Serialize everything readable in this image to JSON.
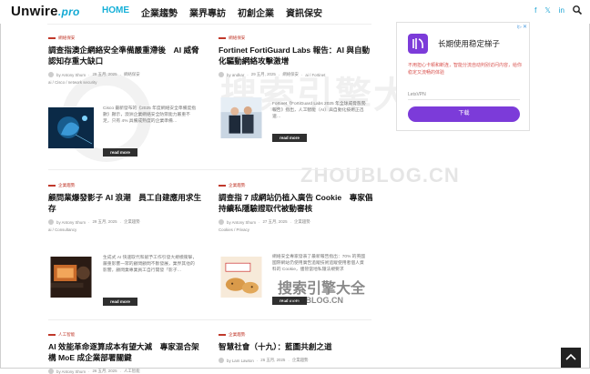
{
  "header": {
    "logo_main": "Unwire",
    "logo_suffix": ".pro",
    "nav": [
      {
        "label": "HOME"
      },
      {
        "label": "企業趨勢"
      },
      {
        "label": "業界專訪"
      },
      {
        "label": "初創企業"
      },
      {
        "label": "資訊保安"
      }
    ],
    "social": [
      "f",
      "𝕏",
      "in"
    ],
    "accent_color": "#16b0d8"
  },
  "articles": [
    {
      "category": "網絡保安",
      "title": "調查指澳企網絡安全準備嚴重滯後　AI 威脅認知存重大缺口",
      "author": "by Antony Shum",
      "date": "29 五月, 2025",
      "category_tag": "網絡保安",
      "tags": "ai / Cisco / network security",
      "excerpt": "Cisco 最新發布的《2025 年度網絡安全準備度指數》顯示，澳洲企業網絡安全防禦能力嚴重不足，只有 4% 具備成熟度的企業準備…",
      "read_more": "read more"
    },
    {
      "category": "網絡保安",
      "title": "Fortinet FortiGuard Labs 報告：AI 與自動化驅動網絡攻擊激增",
      "author": "by andkar",
      "date": "29 五月, 2025",
      "category_tag": "網絡保安",
      "tags": "ai / Fortinet",
      "excerpt": "Fortinet《FortiGuard Labs 2025 年全球威脅態勢報告》指出，人工智能（AI）與自動化技術正迅速…",
      "read_more": "read more"
    },
    {
      "category": "企業趨勢",
      "title": "顧問業爆發影子 AI 浪潮　員工自建應用求生存",
      "author": "by Antony Shum",
      "date": "29 五月, 2025",
      "category_tag": "企業趨勢",
      "tags": "ai / Consultancy",
      "excerpt": "生成式 AI 快速取代和賦予工作引發大規模衝擊，嚴重影響一眾的顧問顧問不斷發展，業界其他的影響，顧問業專業員工自行開發「影子…",
      "read_more": "read more"
    },
    {
      "category": "企業趨勢",
      "title": "調查指 7 成網站仍植入廣告 Cookie　專家倡持續私隱驗證取代被動審核",
      "author": "by Antony Shum",
      "date": "27 五月, 2025",
      "category_tag": "企業趨勢",
      "tags": "Cookies / Privacy",
      "excerpt": "網絡安全專家發表了最新報告指出：70% 的英國國際網站仍使用廣告追蹤技術追蹤使用者個人資料的 Cookie，儘管當地私隱法規要求",
      "read_more": "read more"
    },
    {
      "category": "人工智能",
      "title": "AI 效能革命逐算成本有望大減　專家混合架構 MoE 成企業部署關鍵",
      "author": "by Antony Shum",
      "date": "26 五月, 2025",
      "category_tag": "人工智能"
    },
    {
      "category": "企業趨勢",
      "title": "智慧社會（十九）：藍圖共創之道",
      "author": "by Lam Lawton",
      "date": "26 五月, 2025",
      "category_tag": "企業趨勢"
    }
  ],
  "ad": {
    "marker": "i▷",
    "close": "✕",
    "headline": "长期使用稳定梯子",
    "body": "不用担心卡顿和断连，智能分流自动判别访问内容，给你稳定又流畅的体验",
    "brand": "LetsVPN",
    "button": "下载",
    "brand_color": "#7c3bd9"
  },
  "watermark": {
    "big": "搜索引擎大全",
    "url": "ZHOUBLOG.CN",
    "small_a": "搜索引擎大全",
    "small_b": "ZHOUBLOG.CN"
  }
}
